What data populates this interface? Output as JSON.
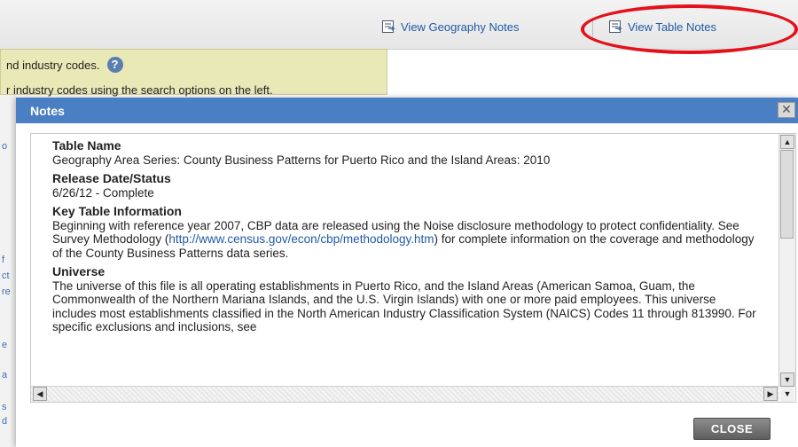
{
  "header": {
    "geography_notes": "View Geography Notes",
    "table_notes": "View Table Notes"
  },
  "info_panel": {
    "line1": "nd industry codes.",
    "line2": "r industry codes using the search options on the left."
  },
  "modal": {
    "title": "Notes",
    "close_label": "CLOSE",
    "sections": [
      {
        "heading": "Table Name",
        "body": "Geography Area Series: County Business Patterns for Puerto Rico and the Island Areas: 2010"
      },
      {
        "heading": "Release Date/Status",
        "body": "6/26/12 - Complete"
      },
      {
        "heading": "Key Table Information",
        "body_before": "Beginning with reference year 2007, CBP data are released using the Noise disclosure methodology to protect confidentiality. See Survey Methodology (",
        "link": "http://www.census.gov/econ/cbp/methodology.htm",
        "body_after": ") for complete information on the coverage and methodology of the County Business Patterns data series."
      },
      {
        "heading": "Universe",
        "body": "The universe of this file is all operating establishments in Puerto Rico, and the Island Areas (American Samoa, Guam, the Commonwealth of the Northern Mariana Islands, and the U.S. Virgin Islands) with one or more paid employees. This universe includes most establishments classified in the North American Industry Classification System (NAICS) Codes 11 through 813990. For specific exclusions and inclusions, see"
      }
    ]
  },
  "colors": {
    "modal_header": "#4a7fc4",
    "link": "#1f5aa6",
    "highlight_ring": "#e3111b",
    "info_panel": "#e9e9b7"
  }
}
